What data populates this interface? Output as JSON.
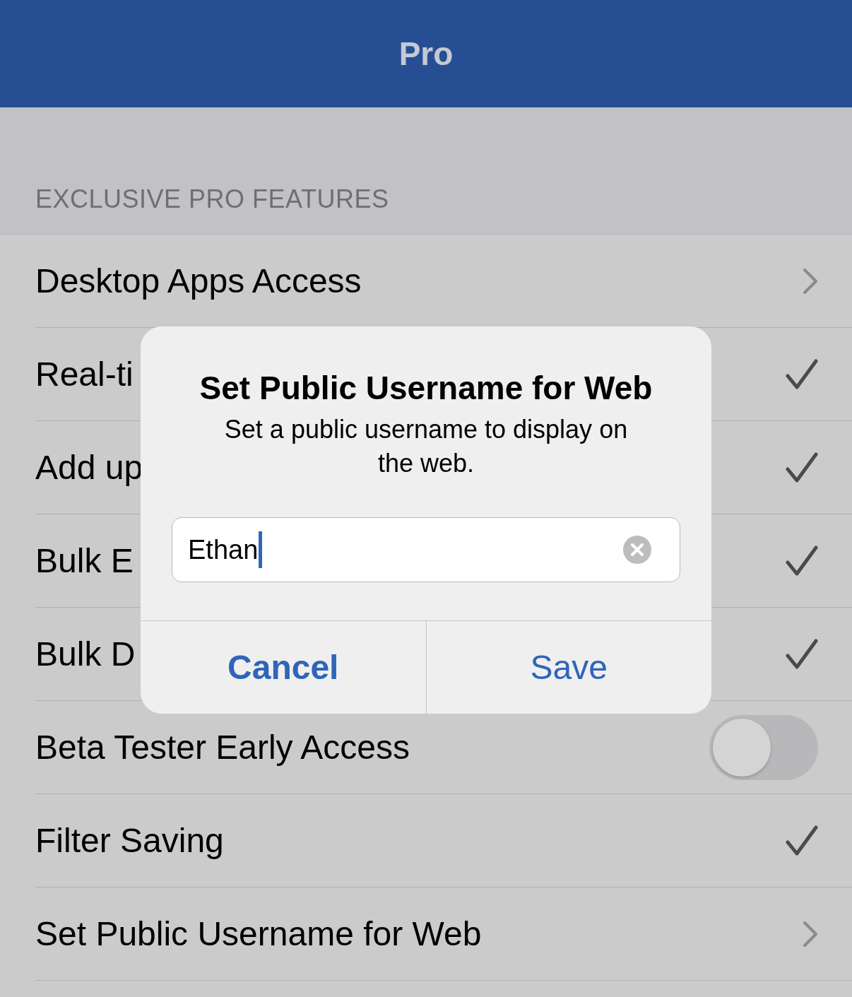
{
  "nav_bar": {
    "title": "Pro"
  },
  "section": {
    "header": "EXCLUSIVE PRO FEATURES"
  },
  "rows": [
    {
      "label": "Desktop Apps Access",
      "kind": "chevron"
    },
    {
      "label": "Real-ti",
      "kind": "check"
    },
    {
      "label": "Add up",
      "kind": "check"
    },
    {
      "label": "Bulk E",
      "kind": "check"
    },
    {
      "label": "Bulk D",
      "kind": "check"
    },
    {
      "label": "Beta Tester Early Access",
      "kind": "toggle",
      "on": false
    },
    {
      "label": "Filter Saving",
      "kind": "check"
    },
    {
      "label": "Set Public Username for Web",
      "kind": "chevron"
    }
  ],
  "dialog": {
    "title": "Set Public Username for Web",
    "message": "Set a public username to display on the web.",
    "field": {
      "value": "Ethan",
      "focused": true
    },
    "buttons": [
      {
        "label": "Cancel",
        "kind": "cancel"
      },
      {
        "label": "Save",
        "kind": "default"
      }
    ]
  }
}
